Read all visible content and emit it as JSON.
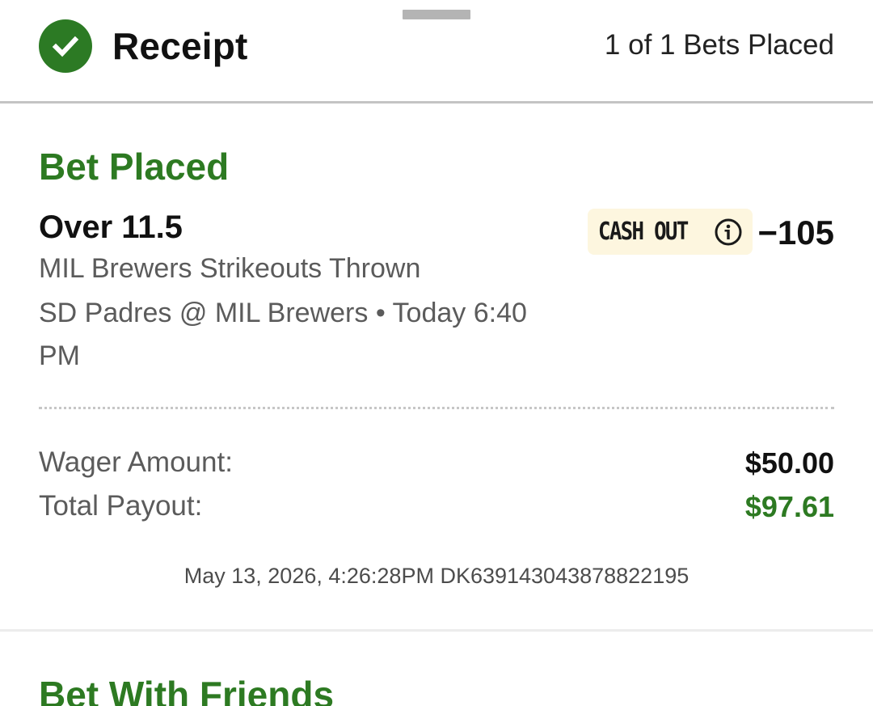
{
  "header": {
    "title": "Receipt",
    "bets_count": "1 of 1 Bets Placed",
    "status_icon": "check-circle-icon"
  },
  "bet": {
    "status": "Bet Placed",
    "selection": "Over 11.5",
    "market": "MIL Brewers Strikeouts Thrown",
    "event": "SD Padres @ MIL Brewers • Today 6:40 PM",
    "cash_out_label": "CASH OUT",
    "odds": "−105",
    "wager_label": "Wager Amount:",
    "wager_value": "$50.00",
    "payout_label": "Total Payout:",
    "payout_value": "$97.61",
    "timestamp": "May 13, 2026, 4:26:28PM DK639143043878822195"
  },
  "friends": {
    "title": "Bet With Friends"
  },
  "colors": {
    "brand_green": "#2d7a22",
    "cashout_bg": "#fdf6df",
    "muted_text": "#5b5b5b"
  }
}
